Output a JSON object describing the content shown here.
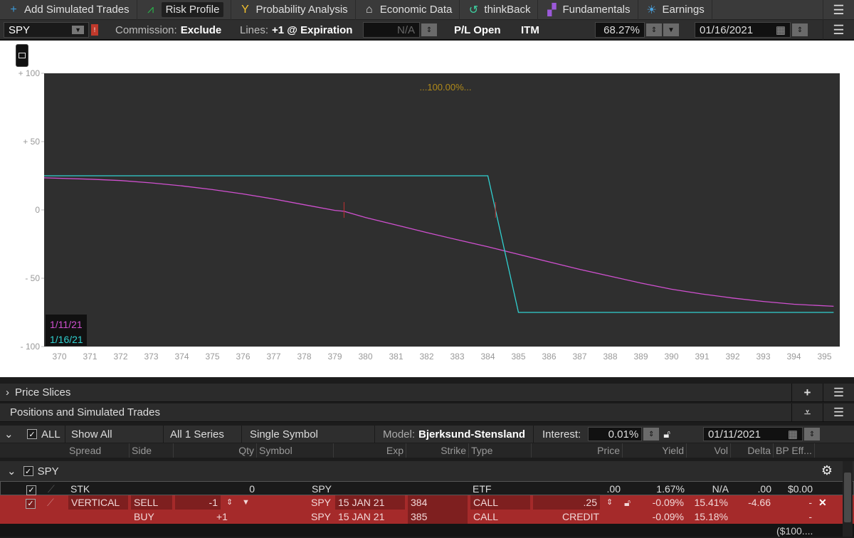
{
  "tabs": [
    {
      "label": "Add Simulated Trades",
      "icon": "plus-icon",
      "glyph": "+",
      "color": "#3a9ad9"
    },
    {
      "label": "Risk Profile",
      "icon": "risk-profile-icon",
      "glyph": "⩘",
      "color": "#2ab24a",
      "active": true
    },
    {
      "label": "Probability Analysis",
      "icon": "probability-icon",
      "glyph": "Y",
      "color": "#f2c12e"
    },
    {
      "label": "Economic Data",
      "icon": "bank-icon",
      "glyph": "⌂",
      "color": "#dddddd"
    },
    {
      "label": "thinkBack",
      "icon": "history-icon",
      "glyph": "↺",
      "color": "#3ecfa0"
    },
    {
      "label": "Fundamentals",
      "icon": "blocks-icon",
      "glyph": "▞",
      "color": "#9b59d9"
    },
    {
      "label": "Earnings",
      "icon": "lightbulb-icon",
      "glyph": "☀",
      "color": "#4aa3e0"
    }
  ],
  "controls": {
    "symbol": "SPY",
    "commission_label": "Commission:",
    "commission_value": "Exclude",
    "lines_label": "Lines:",
    "lines_value": "+1 @ Expiration",
    "na_value": "N/A",
    "pl_open": "P/L Open",
    "itm": "ITM",
    "probability": "68.27%",
    "date": "01/16/2021"
  },
  "chart_data": {
    "type": "line",
    "annotation": "...100.00%...",
    "xlim": [
      369.5,
      395.5
    ],
    "ylim": [
      -100,
      100
    ],
    "x_ticks": [
      370,
      371,
      372,
      373,
      374,
      375,
      376,
      377,
      378,
      379,
      380,
      381,
      382,
      383,
      384,
      385,
      386,
      387,
      388,
      389,
      390,
      391,
      392,
      393,
      394,
      395
    ],
    "y_ticks": [
      100,
      50,
      0,
      -50,
      -100
    ],
    "y_tick_labels": [
      "+ 100",
      "+ 50",
      "0",
      "- 50",
      "- 100"
    ],
    "series": [
      {
        "name": "1/11/21",
        "color": "#d050d0",
        "x": [
          369.5,
          371,
          372,
          373,
          374,
          375,
          376,
          377,
          378,
          379,
          379.3,
          380,
          381,
          382,
          383,
          384,
          385,
          386,
          387,
          388,
          389,
          390,
          391,
          392,
          393,
          394,
          395.3
        ],
        "y": [
          23.5,
          22.5,
          21.5,
          19.8,
          17.6,
          14.9,
          11.7,
          8.0,
          3.8,
          -0.3,
          -1.0,
          -5.5,
          -11.0,
          -16.5,
          -21.8,
          -27.0,
          -32.5,
          -38.0,
          -43.5,
          -48.5,
          -53.5,
          -58.0,
          -61.5,
          -64.5,
          -67.0,
          -69.0,
          -70.5
        ]
      },
      {
        "name": "1/16/21",
        "color": "#30d0d0",
        "x": [
          369.5,
          384,
          385,
          395.3
        ],
        "y": [
          25,
          25,
          -75,
          -75
        ]
      }
    ],
    "markers": [
      {
        "x": 379.3,
        "y": 0,
        "color": "#c03030"
      },
      {
        "x": 384.25,
        "y": 0,
        "color": "#c03030"
      }
    ]
  },
  "price_slices": {
    "label": "Price Slices"
  },
  "positions": {
    "label": "Positions and Simulated Trades"
  },
  "filters": {
    "all": "ALL",
    "show": "Show All",
    "series": "All 1 Series",
    "symbol_mode": "Single Symbol",
    "model_label": "Model:",
    "model_value": "Bjerksund-Stensland",
    "interest_label": "Interest:",
    "interest_value": "0.01%",
    "date": "01/11/2021"
  },
  "columns": [
    "Spread",
    "Side",
    "Qty",
    "Symbol",
    "Exp",
    "Strike",
    "Type",
    "Price",
    "Yield",
    "Vol",
    "Delta",
    "BP Eff..."
  ],
  "group": {
    "name": "SPY"
  },
  "rows": [
    {
      "spread": "STK",
      "side": "",
      "qty": "0",
      "symbol": "SPY",
      "exp": "",
      "strike": "",
      "type": "ETF",
      "price": ".00",
      "yield": "1.67%",
      "vol": "N/A",
      "delta": ".00",
      "bp": "$0.00"
    },
    {
      "spread": "VERTICAL",
      "side": "SELL",
      "qty": "-1",
      "symbol": "SPY",
      "exp": "15 JAN 21",
      "strike": "384",
      "type": "CALL",
      "price": ".25",
      "yield": "-0.09%",
      "vol": "15.41%",
      "delta": "-4.66",
      "bp": "-"
    },
    {
      "spread": "",
      "side": "BUY",
      "qty": "+1",
      "symbol": "SPY",
      "exp": "15 JAN 21",
      "strike": "385",
      "type": "CALL",
      "price": "CREDIT",
      "yield": "-0.09%",
      "vol": "15.18%",
      "delta": "",
      "bp": "-"
    }
  ],
  "footer": {
    "bp_total": "($100...."
  }
}
